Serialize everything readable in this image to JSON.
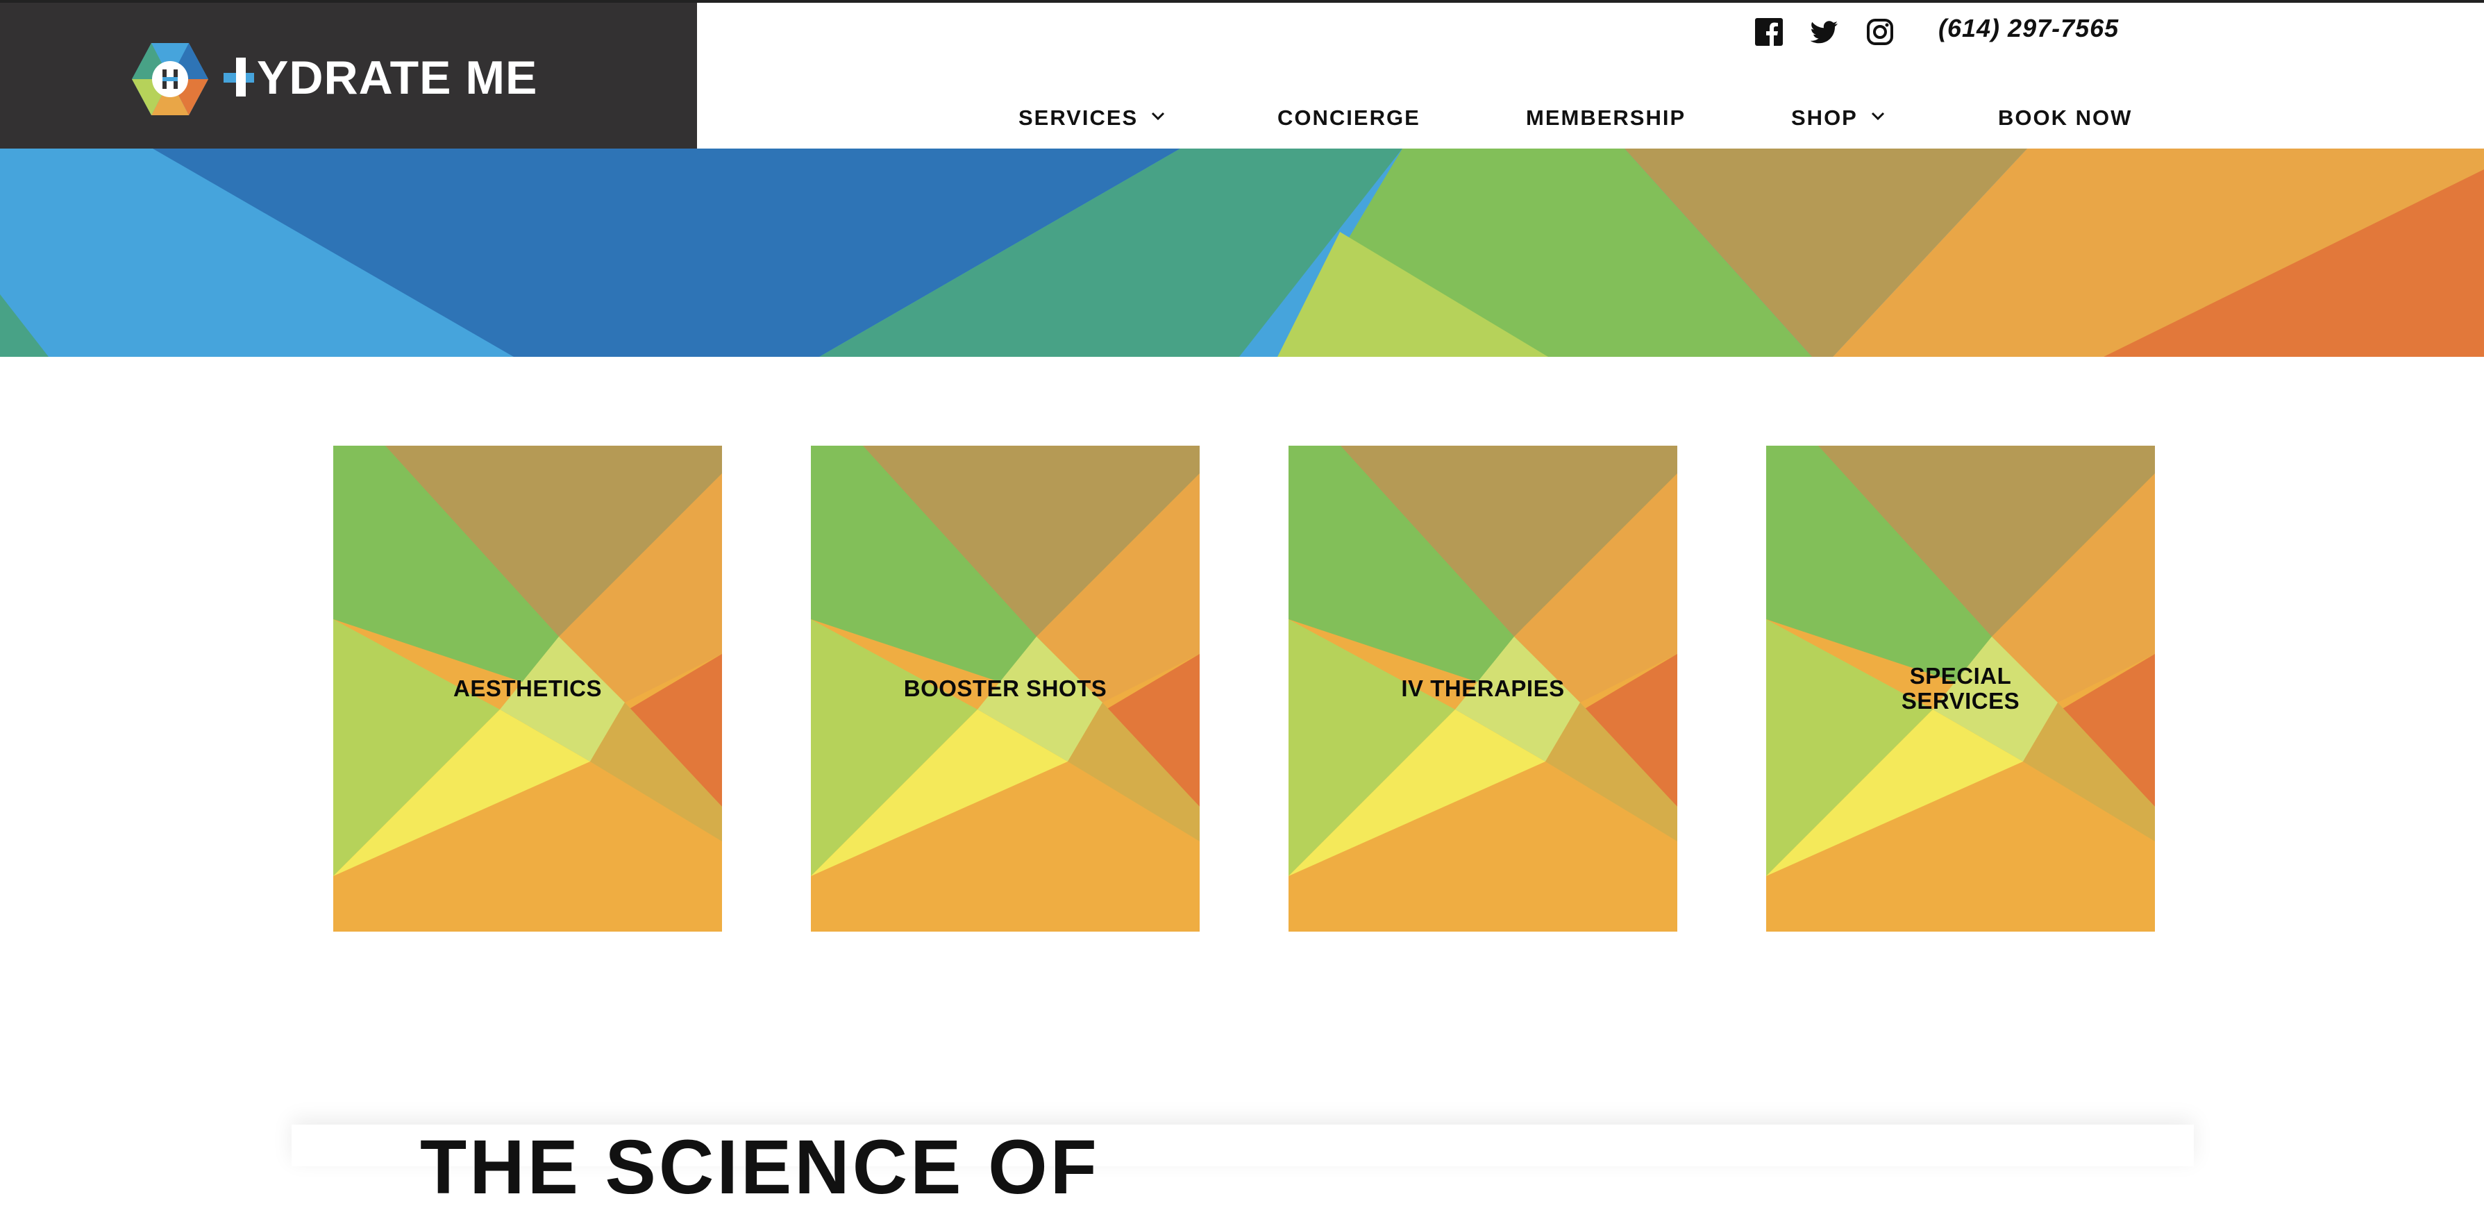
{
  "brand": {
    "name": "HYDRATE ME",
    "name_rest": "YDRATE ME"
  },
  "header": {
    "phone": "(614) 297-7565",
    "social": [
      "facebook-icon",
      "twitter-icon",
      "instagram-icon"
    ]
  },
  "nav": {
    "items": [
      {
        "label": "SERVICES",
        "has_dropdown": true
      },
      {
        "label": "CONCIERGE",
        "has_dropdown": false
      },
      {
        "label": "MEMBERSHIP",
        "has_dropdown": false
      },
      {
        "label": "SHOP",
        "has_dropdown": true
      },
      {
        "label": "BOOK NOW",
        "has_dropdown": false
      }
    ]
  },
  "services": {
    "cards": [
      {
        "label": "AESTHETICS"
      },
      {
        "label": "BOOSTER SHOTS"
      },
      {
        "label": "IV THERAPIES"
      },
      {
        "label": "SPECIAL SERVICES"
      }
    ]
  },
  "section": {
    "heading_partial": "THE SCIENCE OF"
  },
  "colors": {
    "logo_panel": "#333132",
    "blue_light": "#46a4dc",
    "blue_dark": "#2e74b6",
    "teal": "#48a286",
    "green": "#82bf59",
    "olive": "#b59a55",
    "orange": "#e9a647",
    "orange_dark": "#e2783a",
    "lime": "#b6d25a",
    "yellow": "#f4e95a"
  }
}
